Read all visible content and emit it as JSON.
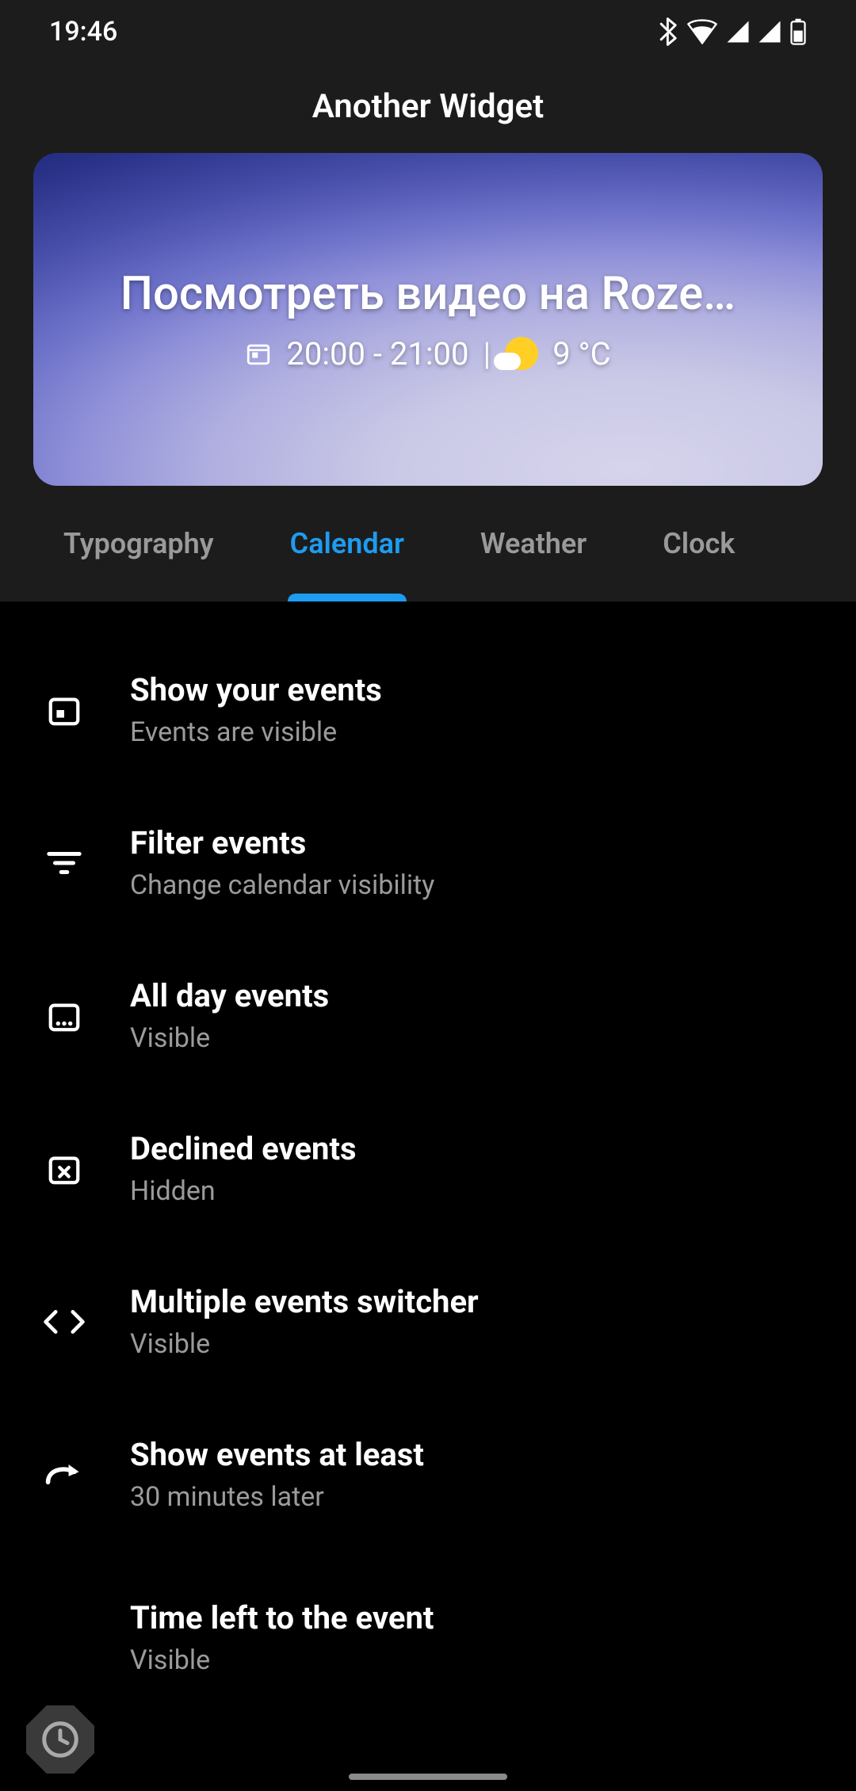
{
  "status": {
    "time": "19:46"
  },
  "title": "Another Widget",
  "preview": {
    "event_title": "Посмотреть видео на Roze…",
    "time_range": "20:00 - 21:00",
    "temperature": "9 °C"
  },
  "tabs": [
    {
      "label": "Typography",
      "active": false
    },
    {
      "label": "Calendar",
      "active": true
    },
    {
      "label": "Weather",
      "active": false
    },
    {
      "label": "Clock",
      "active": false
    }
  ],
  "settings": [
    {
      "icon": "calendar-event-icon",
      "title": "Show your events",
      "subtitle": "Events are visible"
    },
    {
      "icon": "filter-icon",
      "title": "Filter events",
      "subtitle": "Change calendar visibility"
    },
    {
      "icon": "calendar-week-icon",
      "title": "All day events",
      "subtitle": "Visible"
    },
    {
      "icon": "calendar-cancel-icon",
      "title": "Declined events",
      "subtitle": "Hidden"
    },
    {
      "icon": "code-icon",
      "title": "Multiple events switcher",
      "subtitle": "Visible"
    },
    {
      "icon": "redo-icon",
      "title": "Show events at least",
      "subtitle": "30 minutes later"
    },
    {
      "icon": "clock-icon",
      "title": "Time left to the event",
      "subtitle": "Visible"
    }
  ]
}
